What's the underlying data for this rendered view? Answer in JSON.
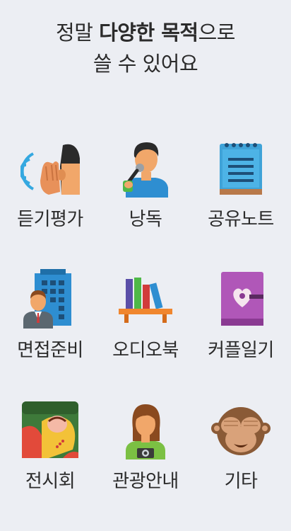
{
  "headline": {
    "line1_pre": "정말 ",
    "line1_bold": "다양한 목적",
    "line1_post": "으로",
    "line2": "쓸 수 있어요"
  },
  "items": [
    {
      "label": "듣기평가",
      "icon": "listening-ear-icon"
    },
    {
      "label": "낭독",
      "icon": "singer-microphone-icon"
    },
    {
      "label": "공유노트",
      "icon": "notepad-icon"
    },
    {
      "label": "면접준비",
      "icon": "businessman-office-icon"
    },
    {
      "label": "오디오북",
      "icon": "bookshelf-icon"
    },
    {
      "label": "커플일기",
      "icon": "heart-diary-icon"
    },
    {
      "label": "전시회",
      "icon": "painting-icon"
    },
    {
      "label": "관광안내",
      "icon": "tourist-camera-icon"
    },
    {
      "label": "기타",
      "icon": "see-no-evil-monkey-icon"
    }
  ],
  "colors": {
    "background": "#eceef3",
    "text": "#2b2b2b"
  }
}
